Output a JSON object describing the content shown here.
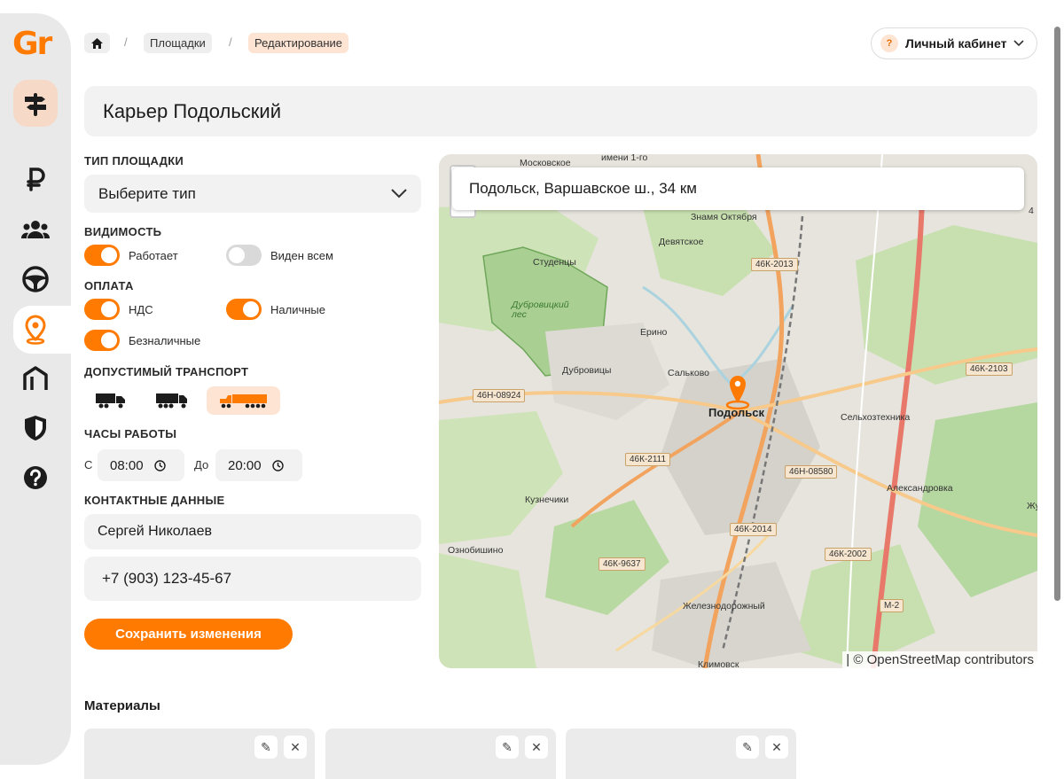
{
  "app": {
    "logo": "Gr"
  },
  "breadcrumb": {
    "items": [
      "Площадки",
      "Редактирование"
    ],
    "separator": "/"
  },
  "account": {
    "badge": "?",
    "label": "Личный кабинет"
  },
  "page": {
    "title": "Карьер Подольский"
  },
  "form": {
    "site_type": {
      "label": "ТИП ПЛОЩАДКИ",
      "value": "Выберите тип"
    },
    "visibility": {
      "label": "ВИДИМОСТЬ",
      "options": [
        {
          "label": "Работает",
          "on": true
        },
        {
          "label": "Виден всем",
          "on": false
        }
      ]
    },
    "payment": {
      "label": "ОПЛАТА",
      "options": [
        {
          "label": "НДС",
          "on": true
        },
        {
          "label": "Наличные",
          "on": true
        },
        {
          "label": "Безналичные",
          "on": true
        }
      ]
    },
    "transport": {
      "label": "ДОПУСТИМЫЙ ТРАНСПОРТ",
      "selected_index": 2
    },
    "hours": {
      "label": "ЧАСЫ РАБОТЫ",
      "from_label": "С",
      "from": "08:00",
      "to_label": "До",
      "to": "20:00"
    },
    "contacts": {
      "label": "КОНТАКТНЫЕ ДАННЫЕ",
      "name": "Сергей Николаев",
      "phone": "+7 (903) 123-45-67"
    },
    "save_label": "Сохранить изменения"
  },
  "map": {
    "search_value": "Подольск, Варшавское ш., 34 км",
    "city": "Подольск",
    "places": [
      "Московское",
      "имени 1-го",
      "Знамя Октября",
      "Девятское",
      "Студенцы",
      "Дубровицкий лес",
      "Ерино",
      "Дубровицы",
      "Сальково",
      "Сельхозтехника",
      "Кузнечики",
      "Александровка",
      "Ознобишино",
      "Железнодорожный",
      "Климовск",
      "Жу",
      "4"
    ],
    "roads": [
      "46К-2013",
      "46Н-08924",
      "46К-2103",
      "46К-2111",
      "46Н-08580",
      "46К-2014",
      "46К-9637",
      "46К-2002",
      "М-2"
    ],
    "attribution": "| © OpenStreetMap contributors",
    "colors": {
      "forest": "#b5d7a0",
      "urban": "#d8d6cf",
      "road_major": "#f2a35e",
      "river": "#aad3df"
    }
  },
  "materials": {
    "title": "Материалы",
    "edit_icon": "✎",
    "remove_icon": "✕"
  },
  "theme": {
    "accent": "#ff7a00",
    "accent_soft": "#fde4d3",
    "sidebar_bg": "#e9e9e9"
  }
}
